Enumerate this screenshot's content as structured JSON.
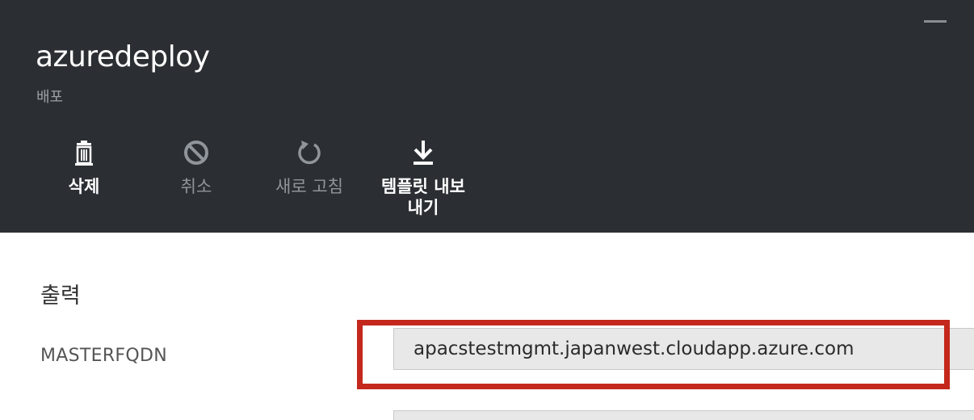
{
  "blade": {
    "title": "azuredeploy",
    "subtitle": "배포"
  },
  "commands": [
    {
      "label": "삭제",
      "icon": "trash-icon",
      "enabled": true
    },
    {
      "label": "취소",
      "icon": "cancel-icon",
      "enabled": false
    },
    {
      "label": "새로 고침",
      "icon": "refresh-icon",
      "enabled": false
    },
    {
      "label": "템플릿 내보내기",
      "icon": "download-icon",
      "enabled": true
    }
  ],
  "outputs": {
    "section_title": "출력",
    "items": [
      {
        "name": "MASTERFQDN",
        "value": "apacstestmgmt.japanwest.cloudapp.azure.com"
      }
    ]
  },
  "colors": {
    "header_bg": "#2b2f33",
    "highlight": "#c4281c",
    "field_bg": "#e8e8e8"
  }
}
